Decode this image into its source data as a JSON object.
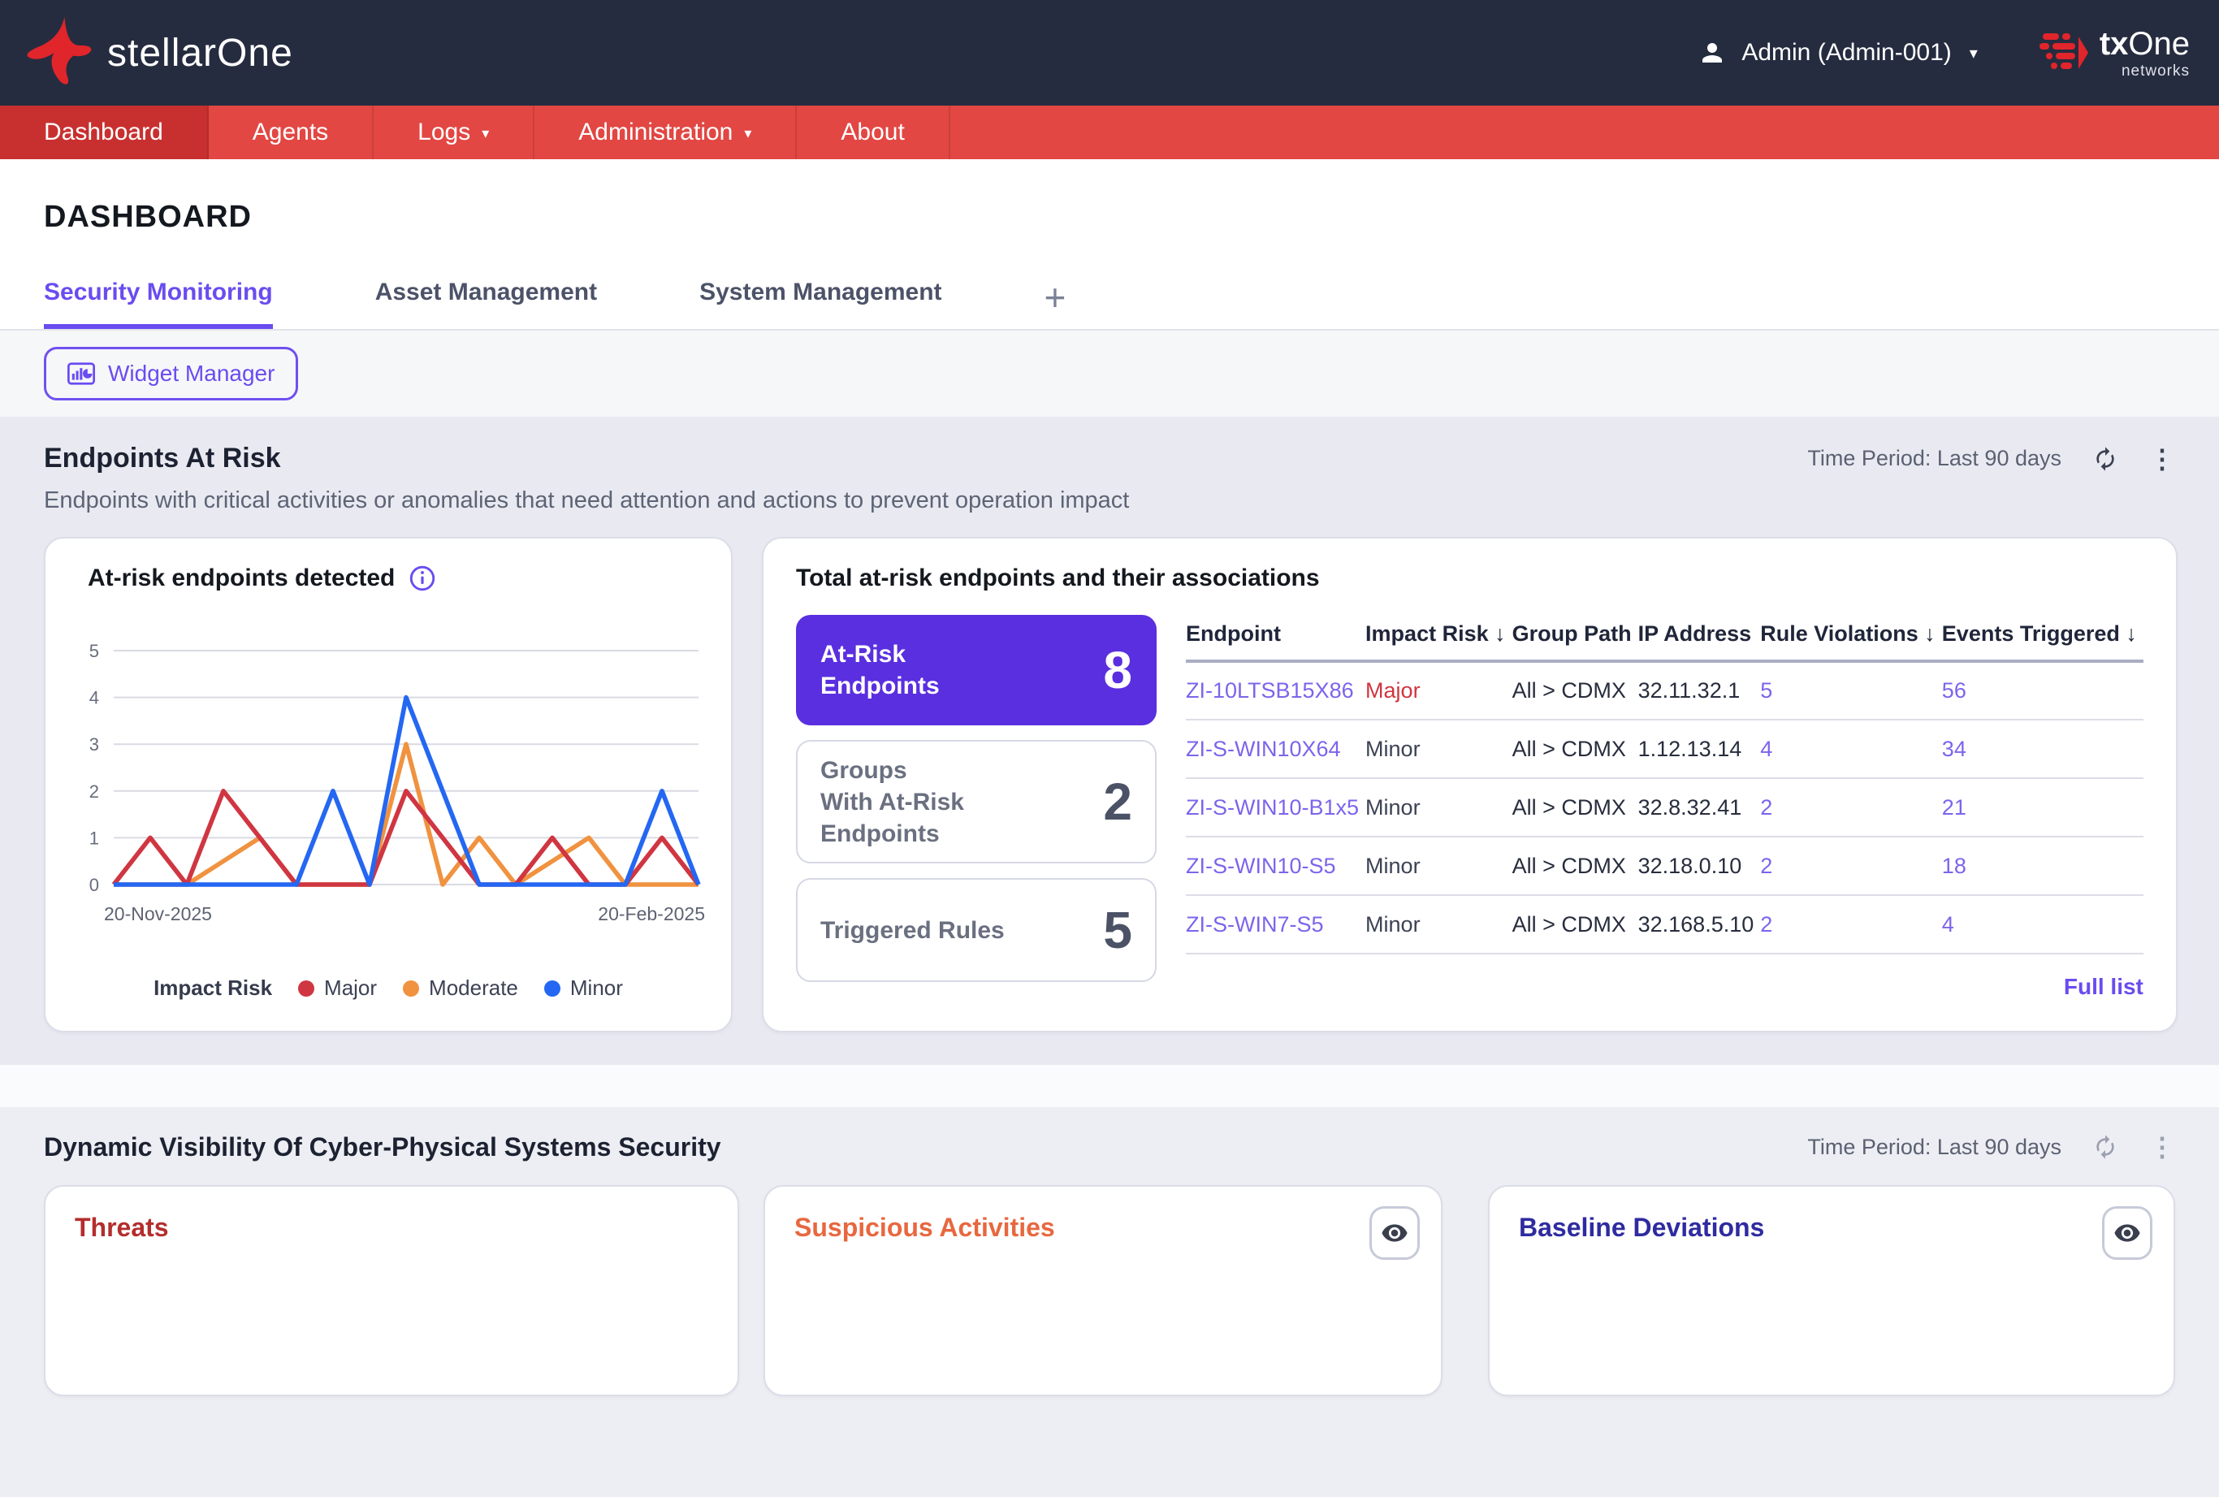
{
  "header": {
    "logo_text": "stellarOne",
    "user_name": "Admin (Admin-001)",
    "caret": "▾",
    "brand": {
      "tx": "tx",
      "one": "One",
      "sub": "networks"
    }
  },
  "nav": {
    "caret": "▾",
    "items": [
      {
        "label": "Dashboard",
        "active": true,
        "dropdown": false
      },
      {
        "label": "Agents",
        "active": false,
        "dropdown": false
      },
      {
        "label": "Logs",
        "active": false,
        "dropdown": true
      },
      {
        "label": "Administration",
        "active": false,
        "dropdown": true
      },
      {
        "label": "About",
        "active": false,
        "dropdown": false
      }
    ]
  },
  "page": {
    "title": "DASHBOARD",
    "tabs": [
      {
        "label": "Security Monitoring",
        "active": true
      },
      {
        "label": "Asset Management",
        "active": false
      },
      {
        "label": "System Management",
        "active": false
      }
    ],
    "add_tab_label": "+",
    "widget_manager_label": "Widget Manager"
  },
  "endpoints_section": {
    "title": "Endpoints At Risk",
    "subtitle": "Endpoints with critical activities or anomalies that need attention and actions to prevent operation impact",
    "time_period": "Time Period: Last 90 days"
  },
  "chart_card": {
    "title": "At-risk endpoints detected"
  },
  "chart_data": {
    "type": "line",
    "title": "At-risk endpoints detected",
    "x_labels": [
      "20-Nov-2025",
      "20-Feb-2025"
    ],
    "ylim": [
      0,
      5
    ],
    "yticks": [
      0,
      1,
      2,
      3,
      4,
      5
    ],
    "grid": true,
    "legend_position": "bottom",
    "legend": {
      "title": "Impact Risk",
      "items": [
        {
          "label": "Major",
          "color": "#cf3642"
        },
        {
          "label": "Moderate",
          "color": "#f0923f"
        },
        {
          "label": "Minor",
          "color": "#2467f2"
        }
      ]
    },
    "series": [
      {
        "name": "Moderate",
        "color": "#f0923f",
        "values": [
          0,
          0,
          0,
          0.5,
          1,
          0,
          0,
          0,
          3,
          0,
          1,
          0,
          0.5,
          1,
          0,
          0,
          0
        ]
      },
      {
        "name": "Major",
        "color": "#cf3642",
        "values": [
          0,
          1,
          0,
          2,
          1,
          0,
          0,
          0,
          2,
          1,
          0,
          0,
          1,
          0,
          0,
          1,
          0
        ]
      },
      {
        "name": "Minor",
        "color": "#2467f2",
        "values": [
          0,
          0,
          0,
          0,
          0,
          0,
          2,
          0,
          4,
          2,
          0,
          0,
          0,
          0,
          0,
          2,
          0
        ]
      }
    ]
  },
  "associations_card": {
    "title": "Total at-risk endpoints and their associations",
    "stats": [
      {
        "label": "At-Risk\nEndpoints",
        "value": "8",
        "selected": true
      },
      {
        "label": "Groups\nWith At-Risk\nEndpoints",
        "value": "2",
        "selected": false
      },
      {
        "label": "Triggered Rules",
        "value": "5",
        "selected": false
      }
    ],
    "table": {
      "columns": [
        "Endpoint",
        "Impact Risk ↓",
        "Group Path",
        "IP Address",
        "Rule Violations ↓",
        "Events Triggered ↓"
      ],
      "rows": [
        {
          "endpoint": "ZI-10LTSB15X86",
          "impact": "Major",
          "group": "All > CDMX",
          "ip": "32.11.32.1",
          "violations": "5",
          "events": "56"
        },
        {
          "endpoint": "ZI-S-WIN10X64",
          "impact": "Minor",
          "group": "All > CDMX",
          "ip": "1.12.13.14",
          "violations": "4",
          "events": "34"
        },
        {
          "endpoint": "ZI-S-WIN10-B1x5",
          "impact": "Minor",
          "group": "All > CDMX",
          "ip": "32.8.32.41",
          "violations": "2",
          "events": "21"
        },
        {
          "endpoint": "ZI-S-WIN10-S5",
          "impact": "Minor",
          "group": "All > CDMX",
          "ip": "32.18.0.10",
          "violations": "2",
          "events": "18"
        },
        {
          "endpoint": "ZI-S-WIN7-S5",
          "impact": "Minor",
          "group": "All > CDMX",
          "ip": "32.168.5.10",
          "violations": "2",
          "events": "4"
        }
      ]
    },
    "full_list_label": "Full list"
  },
  "visibility_section": {
    "title": "Dynamic Visibility Of Cyber-Physical Systems Security",
    "time_period": "Time Period: Last 90 days",
    "cards": [
      {
        "title": "Threats",
        "color": "#b42d2d"
      },
      {
        "title": "Suspicious Activities",
        "color": "#e8673f"
      },
      {
        "title": "Baseline Deviations",
        "color": "#2f2ba0"
      }
    ]
  },
  "colors": {
    "topbar": "#262c3f",
    "nav": "#e24743",
    "nav_active": "#c83030",
    "accent_purple": "#6a4cf0",
    "stat_selected": "#5a2fdf",
    "section_bg": "#e9eaf1",
    "major_red": "#d0343f"
  }
}
